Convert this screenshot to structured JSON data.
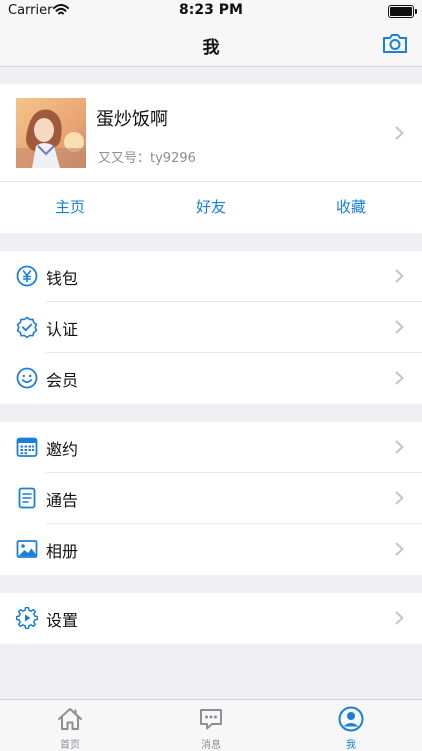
{
  "status_bar": {
    "carrier": "Carrier",
    "time": "8:23 PM"
  },
  "nav": {
    "title": "我"
  },
  "profile": {
    "name": "蛋炒饭啊",
    "id_label": "又又号：",
    "id_value": "ty9296",
    "links": [
      "主页",
      "好友",
      "收藏"
    ]
  },
  "menu": {
    "group1": [
      {
        "label": "钱包",
        "icon": "yuan-circle-icon"
      },
      {
        "label": "认证",
        "icon": "verified-badge-icon"
      },
      {
        "label": "会员",
        "icon": "smiley-icon"
      }
    ],
    "group2": [
      {
        "label": "邀约",
        "icon": "calendar-icon"
      },
      {
        "label": "通告",
        "icon": "document-icon"
      },
      {
        "label": "相册",
        "icon": "photo-icon"
      }
    ],
    "group3": [
      {
        "label": "设置",
        "icon": "settings-gear-icon"
      }
    ]
  },
  "tabs": [
    {
      "label": "首页",
      "icon": "home-icon",
      "active": false
    },
    {
      "label": "消息",
      "icon": "chat-icon",
      "active": false
    },
    {
      "label": "我",
      "icon": "person-icon",
      "active": true
    }
  ],
  "colors": {
    "accent": "#1a7fd8",
    "background": "#efeff4",
    "secondary_text": "#8e8e93"
  }
}
